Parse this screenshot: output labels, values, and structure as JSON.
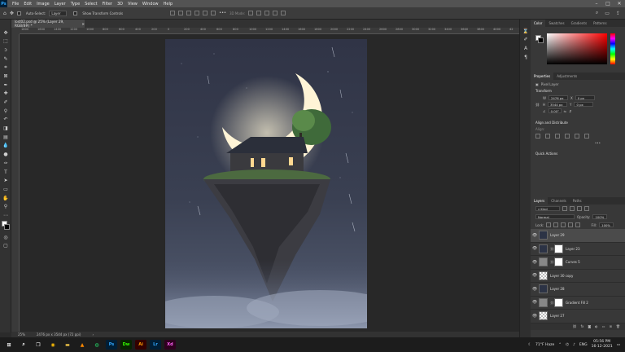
{
  "app": {
    "name": "Ps"
  },
  "menu": [
    "File",
    "Edit",
    "Image",
    "Layer",
    "Type",
    "Select",
    "Filter",
    "3D",
    "View",
    "Window",
    "Help"
  ],
  "window_controls": [
    "–",
    "□",
    "✕"
  ],
  "options_bar": {
    "auto_select_label": "Auto-Select:",
    "auto_select_value": "Layer",
    "show_transform_label": "Show Transform Controls",
    "mode_3d": "3D Mode:"
  },
  "document": {
    "tab_title": "lost02.psd @ 25% (Layer 29, RGB/8#) *"
  },
  "ruler_ticks": [
    "1800",
    "1600",
    "1400",
    "1200",
    "1000",
    "800",
    "600",
    "400",
    "200",
    "0",
    "200",
    "400",
    "600",
    "800",
    "1000",
    "1200",
    "1400",
    "1600",
    "1800",
    "2000",
    "2200",
    "2400",
    "2600",
    "2800",
    "3000",
    "3200",
    "3400",
    "3600",
    "3800",
    "4000",
    "42"
  ],
  "status": {
    "zoom": "25%",
    "info": "2476 px x 3544 px (72 ppi)"
  },
  "color_panel": {
    "tabs": [
      "Color",
      "Swatches",
      "Gradients",
      "Patterns"
    ]
  },
  "properties_panel": {
    "tabs": [
      "Properties",
      "Adjustments"
    ],
    "layer_kind": "Pixel Layer",
    "transform_title": "Transform",
    "w_label": "W",
    "w_value": "2476 px",
    "h_label": "H",
    "h_value": "3544 px",
    "x_label": "X",
    "x_value": "0 px",
    "y_label": "Y",
    "y_value": "0 px",
    "angle_value": "0.00°",
    "align_title": "Align and Distribute",
    "align_label": "Align:",
    "quick_title": "Quick Actions"
  },
  "layers_panel": {
    "tabs": [
      "Layers",
      "Channels",
      "Paths"
    ],
    "filter_kind": "Kind",
    "blend_mode": "Normal",
    "opacity_label": "Opacity:",
    "opacity_value": "100%",
    "lock_label": "Lock:",
    "fill_label": "Fill:",
    "fill_value": "100%",
    "layers": [
      {
        "name": "Layer 29",
        "thumb": "dark",
        "mask": false,
        "selected": true
      },
      {
        "name": "Layer 23",
        "thumb": "dark",
        "mask": true,
        "selected": false
      },
      {
        "name": "Curves 5",
        "thumb": "gray",
        "mask": true,
        "selected": false
      },
      {
        "name": "Layer 30 copy",
        "thumb": "checker",
        "mask": false,
        "selected": false
      },
      {
        "name": "Layer 28",
        "thumb": "dark",
        "mask": false,
        "selected": false
      },
      {
        "name": "Gradient Fill 2",
        "thumb": "gray",
        "mask": true,
        "selected": false
      },
      {
        "name": "Layer 27",
        "thumb": "checker",
        "mask": false,
        "selected": false
      }
    ]
  },
  "taskbar": {
    "apps": [
      {
        "label": "Ps",
        "color": "#31a8ff",
        "bg": "#001e36"
      },
      {
        "label": "Dw",
        "color": "#35fa00",
        "bg": "#072401"
      },
      {
        "label": "Ai",
        "color": "#ff9a00",
        "bg": "#330000"
      },
      {
        "label": "Lr",
        "color": "#31a8ff",
        "bg": "#001e36"
      },
      {
        "label": "Xd",
        "color": "#ff61f6",
        "bg": "#2e001f"
      }
    ],
    "weather": "71°F Haze",
    "lang": "ENG",
    "time": "05:56 PM",
    "date": "16-12-2021"
  }
}
